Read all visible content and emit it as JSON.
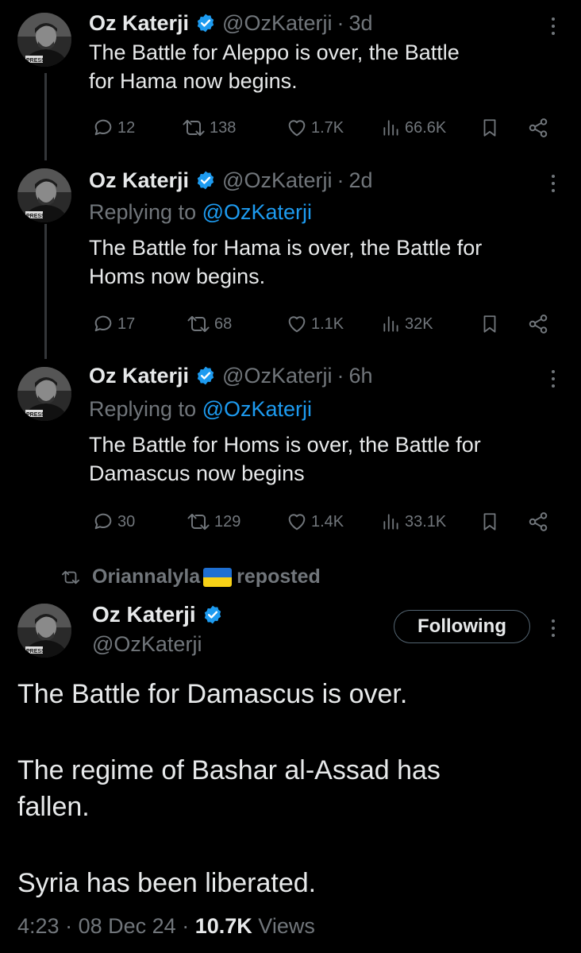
{
  "tweets": [
    {
      "name": "Oz Katerji",
      "handle": "@OzKaterji",
      "separator": "·",
      "time": "3d",
      "reply_prefix": "",
      "reply_mention": "",
      "text_lines": [
        "The Battle for Aleppo is over, the Battle",
        "for Hama now begins."
      ],
      "replies": "12",
      "reposts": "138",
      "likes": "1.7K",
      "views": "66.6K"
    },
    {
      "name": "Oz Katerji",
      "handle": "@OzKaterji",
      "separator": "·",
      "time": "2d",
      "reply_prefix": "Replying to ",
      "reply_mention": "@OzKaterji",
      "text_lines": [
        "The Battle for Hama is over, the Battle for",
        "Homs now begins."
      ],
      "replies": "17",
      "reposts": "68",
      "likes": "1.1K",
      "views": "32K"
    },
    {
      "name": "Oz Katerji",
      "handle": "@OzKaterji",
      "separator": "·",
      "time": "6h",
      "reply_prefix": "Replying to ",
      "reply_mention": "@OzKaterji",
      "text_lines": [
        "The Battle for Homs is over, the Battle for",
        "Damascus now begins"
      ],
      "replies": "30",
      "reposts": "129",
      "likes": "1.4K",
      "views": "33.1K"
    }
  ],
  "repost_banner": {
    "user": "Oriannalyla",
    "label": "reposted"
  },
  "main_tweet": {
    "name": "Oz Katerji",
    "handle": "@OzKaterji",
    "follow_label": "Following",
    "paragraphs": [
      "The Battle for Damascus is over.",
      "The regime of Bashar al-Assad has",
      "fallen.",
      "Syria has been liberated."
    ],
    "time": "4:23",
    "date": "08 Dec 24",
    "separator": "·",
    "views_count": "10.7K",
    "views_label": "Views"
  },
  "colors": {
    "background": "#000000",
    "text_primary": "#e7e9ea",
    "text_secondary": "#71767b",
    "accent": "#1d9bf0",
    "thread_line": "#333639"
  },
  "icons": {
    "verified": "verified-badge-icon",
    "reply": "reply-icon",
    "repost": "repost-icon",
    "like": "heart-icon",
    "views": "views-bar-chart-icon",
    "bookmark": "bookmark-icon",
    "share": "share-icon",
    "more": "more-vertical-icon",
    "flag": "ukraine-flag-icon"
  }
}
